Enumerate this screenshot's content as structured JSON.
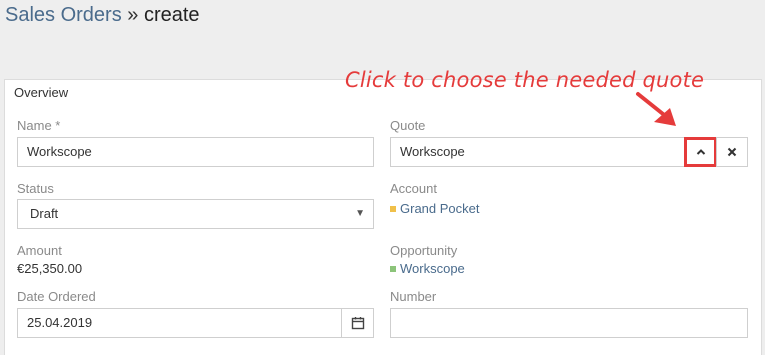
{
  "breadcrumb": {
    "parent": "Sales Orders",
    "separator": "»",
    "current": "create"
  },
  "panel": {
    "title": "Overview"
  },
  "annotation": {
    "text": "Click to choose the needed quote"
  },
  "fields": {
    "name": {
      "label": "Name *",
      "value": "Workscope"
    },
    "quote": {
      "label": "Quote",
      "value": "Workscope"
    },
    "status": {
      "label": "Status",
      "value": "Draft"
    },
    "account": {
      "label": "Account",
      "value": "Grand Pocket",
      "color": "#f0c04a"
    },
    "amount": {
      "label": "Amount",
      "value": "€25,350.00"
    },
    "opportunity": {
      "label": "Opportunity",
      "value": "Workscope",
      "color": "#8cc47a"
    },
    "date_ordered": {
      "label": "Date Ordered",
      "value": "25.04.2019"
    },
    "number": {
      "label": "Number",
      "value": ""
    }
  },
  "colors": {
    "annotation": "#e53b3b",
    "link": "#4a6b8c"
  },
  "icons": {
    "select_quote": "chevron-up-icon",
    "clear_quote": "close-icon",
    "status_dropdown": "caret-down-icon",
    "date_picker": "calendar-icon"
  }
}
